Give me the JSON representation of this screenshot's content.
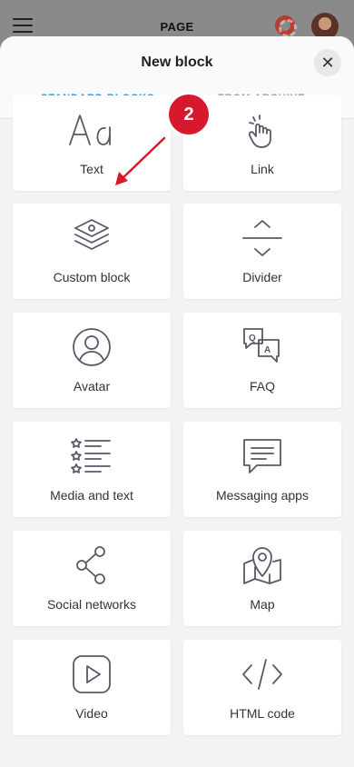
{
  "page_header": {
    "title": "PAGE"
  },
  "sheet": {
    "title": "New block",
    "close_label": "✕"
  },
  "tabs": [
    {
      "label": "STANDARD BLOCKS",
      "active": true
    },
    {
      "label": "FROM ARCHIVE",
      "active": false
    }
  ],
  "blocks": [
    {
      "label": "Text",
      "icon": "text-aa-icon"
    },
    {
      "label": "Link",
      "icon": "pointer-hand-icon"
    },
    {
      "label": "Custom block",
      "icon": "layers-icon"
    },
    {
      "label": "Divider",
      "icon": "divider-icon"
    },
    {
      "label": "Avatar",
      "icon": "user-circle-icon"
    },
    {
      "label": "FAQ",
      "icon": "qa-bubbles-icon"
    },
    {
      "label": "Media and text",
      "icon": "star-list-icon"
    },
    {
      "label": "Messaging apps",
      "icon": "chat-bubble-icon"
    },
    {
      "label": "Social networks",
      "icon": "share-icon"
    },
    {
      "label": "Map",
      "icon": "map-pin-icon"
    },
    {
      "label": "Video",
      "icon": "play-icon"
    },
    {
      "label": "HTML code",
      "icon": "code-icon"
    }
  ],
  "annotation": {
    "step": "2"
  },
  "colors": {
    "accent": "#2f8fd6",
    "badge": "#d8182c"
  }
}
